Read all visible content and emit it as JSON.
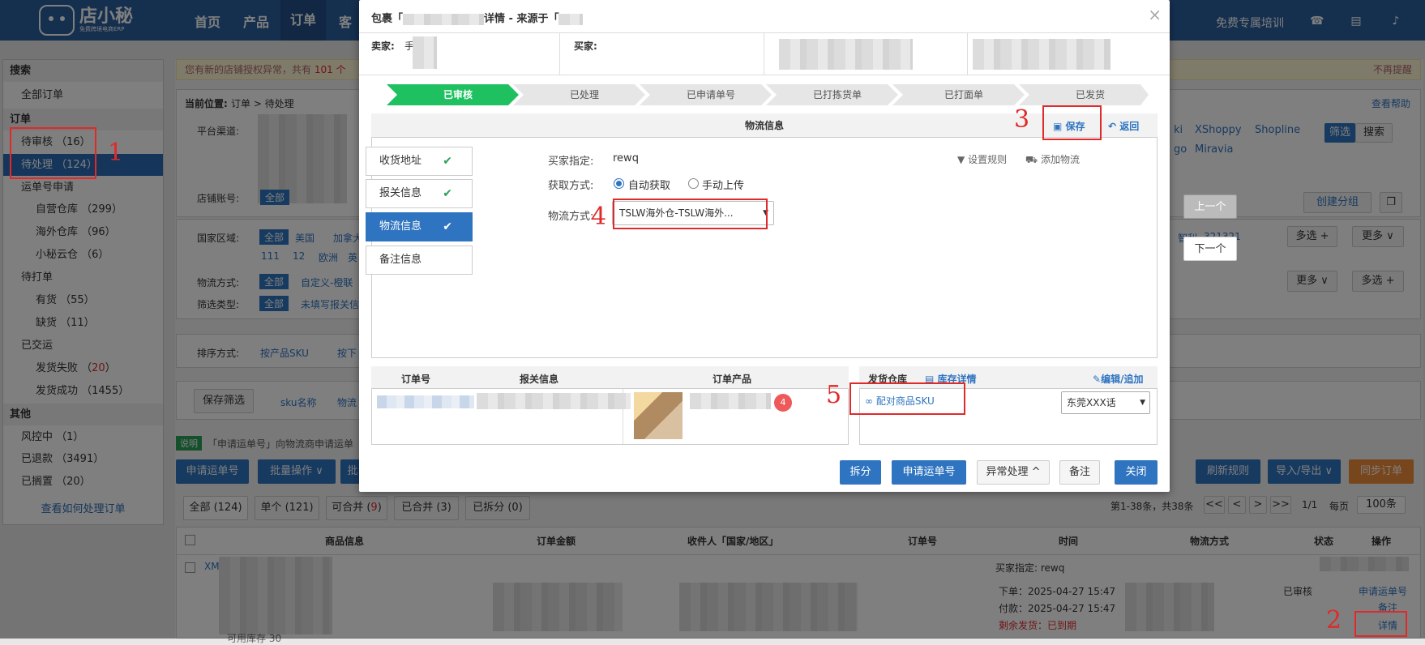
{
  "topbar": {
    "logo_name": "店小秘",
    "logo_sub": "免费跨境电商ERP",
    "nav": [
      "首页",
      "产品",
      "订单",
      "客"
    ],
    "right_text": "免费专属培训"
  },
  "sidebar": {
    "search_header": "搜索",
    "all_orders": "全部订单",
    "order_header": "订单",
    "pending_review": "待审核 （16）",
    "pending_process": "待处理 （124）",
    "waybill_apply": "运单号申请",
    "own_warehouse": "自营仓库 （299）",
    "overseas_warehouse": "海外仓库 （96）",
    "cloud_warehouse": "小秘云仓 （6）",
    "to_print": "待打单",
    "in_stock": "有货 （55）",
    "out_of_stock": "缺货 （11）",
    "shipped": "已交运",
    "ship_failed_label": "发货失败 （",
    "ship_failed_count": "20",
    "ship_failed_close": "）",
    "ship_success": "发货成功 （1455）",
    "other_header": "其他",
    "risk": "风控中 （1）",
    "refunded": "已退款 （3491）",
    "shelved": "已搁置 （20）",
    "howto_link": "查看如何处理订单"
  },
  "main": {
    "notice": "您有新的店铺授权异常，共有",
    "notice_count": "101 个",
    "notice_dismiss": "不再提醒",
    "breadcrumb_label": "当前位置:",
    "breadcrumb_path": "订单 > 待处理",
    "help": "查看帮助",
    "platform_label": "平台渠道:",
    "platforms": [
      "ki",
      "XShoppy",
      "Shopline",
      "go",
      "Miravia"
    ],
    "filter_btn": "筛选",
    "search_btn": "搜索",
    "shop_label": "店铺账号:",
    "all_tag": "全部",
    "create_group": "创建分组",
    "country_label": "国家区域:",
    "countries": [
      "美国",
      "加拿大"
    ],
    "country_row2": [
      "111",
      "12",
      "欧洲",
      "英"
    ],
    "country_right": [
      "智利",
      "321321"
    ],
    "multi": "多选 +",
    "more": "更多 ∨",
    "logistics_label": "物流方式:",
    "logistics_val": "自定义-橙联",
    "filter_type_label": "筛选类型:",
    "filter_type_val": "未填写报关信",
    "sort_label": "排序方式:",
    "sort_by_sku": "按产品SKU",
    "sort_by_2": "按下",
    "save_filter": "保存筛选",
    "sku_name": "sku名称",
    "logistics_short": "物流",
    "info_tag": "说明",
    "info_text": "「申请运单号」向物流商申请运单",
    "apply_waybill": "申请运单号",
    "batch_ops": "批量操作 ∨",
    "batch_short": "批",
    "refresh_rules": "刷新规则",
    "import_export": "导入/导出 ∨",
    "sync_orders": "同步订单",
    "tabs": [
      "全部 (124)",
      "单个 (121)",
      "可合并 (",
      "已合并 (3)",
      "已拆分 (0)"
    ],
    "mergeable_count": "9",
    "mergeable_close": ")",
    "pager_text": "第1-38条，共38条",
    "pager_buttons": [
      "<<",
      "<",
      ">",
      ">>"
    ],
    "pager_page": "1/1",
    "per_page_label": "每页",
    "per_page": "100条",
    "table_headers": [
      "商品信息",
      "订单金额",
      "收件人「国家/地区」",
      "订单号",
      "时间",
      "物流方式",
      "状态",
      "操作"
    ],
    "row_prefix": "XM",
    "row_buyer_label": "买家指定:",
    "row_buyer_val": "rewq",
    "row_order_time": "下单：2025-04-27 15:47",
    "row_pay_time": "付款：2025-04-27 15:47",
    "row_remaining_label": "剩余发货：",
    "row_remaining_val": "已到期",
    "row_status": "已审核",
    "row_ops": [
      "申请运单号",
      "备注",
      "详情"
    ],
    "row_small": "可用库存",
    "row_small_count": "30"
  },
  "nav_float": {
    "prev": "上一个",
    "next": "下一个"
  },
  "modal": {
    "title_prefix": "包裹「",
    "title_suffix": "详情 - 来源于「",
    "seller_label": "卖家:",
    "seller_val": "手",
    "buyer_label": "买家:",
    "steps": [
      "已审核",
      "已处理",
      "已申请单号",
      "已打拣货单",
      "已打面单",
      "已发货"
    ],
    "section_title": "物流信息",
    "save": "保存",
    "back": "返回",
    "tabs": [
      "收货地址",
      "报关信息",
      "物流信息",
      "备注信息"
    ],
    "buyer_spec_label": "买家指定:",
    "buyer_spec_val": "rewq",
    "set_rule": "设置规则",
    "add_logistics": "添加物流",
    "fetch_label": "获取方式:",
    "auto_fetch": "自动获取",
    "manual_upload": "手动上传",
    "method_label": "物流方式:",
    "method_val": "TSLW海外仓-TSLW海外...",
    "table_cols": [
      "订单号",
      "报关信息",
      "订单产品"
    ],
    "product_count": "4",
    "warehouse_label": "发货仓库",
    "stock_detail": "库存详情",
    "edit_add": "编辑/追加",
    "match_sku": "配对商品SKU",
    "warehouse_val": "东莞XXX话",
    "footer": {
      "split": "拆分",
      "apply": "申请运单号",
      "exception": "异常处理 ^",
      "remark": "备注",
      "close": "关闭"
    }
  },
  "annotations": [
    "1",
    "2",
    "3",
    "4",
    "5"
  ],
  "colors": {
    "brand": "#2b5f9e",
    "step_active": "#1ec060",
    "annotation": "#e02a2a"
  }
}
